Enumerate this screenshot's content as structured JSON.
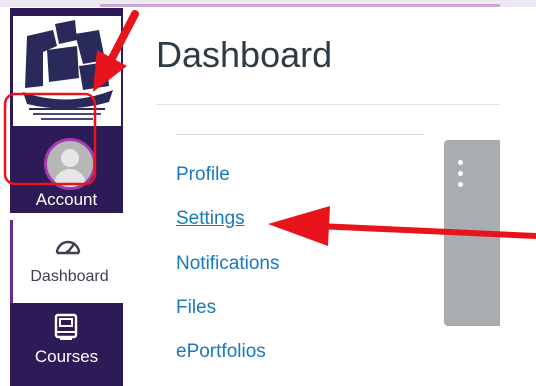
{
  "header": {
    "title": "Dashboard"
  },
  "sidebar": {
    "account": {
      "label": "Account",
      "icon": "user-avatar-icon"
    },
    "dashboard": {
      "label": "Dashboard",
      "icon": "speedometer-icon"
    },
    "courses": {
      "label": "Courses",
      "icon": "book-icon"
    },
    "colors": {
      "nav_bg": "#2d1b58",
      "active_border": "#6a2d8f",
      "avatar_ring": "#a33bb0"
    }
  },
  "account_tray": {
    "links": [
      {
        "label": "Profile"
      },
      {
        "label": "Settings"
      },
      {
        "label": "Notifications"
      },
      {
        "label": "Files"
      },
      {
        "label": "ePortfolios"
      }
    ],
    "link_color": "#1a78be"
  },
  "annotations": {
    "color": "#e8141c"
  }
}
